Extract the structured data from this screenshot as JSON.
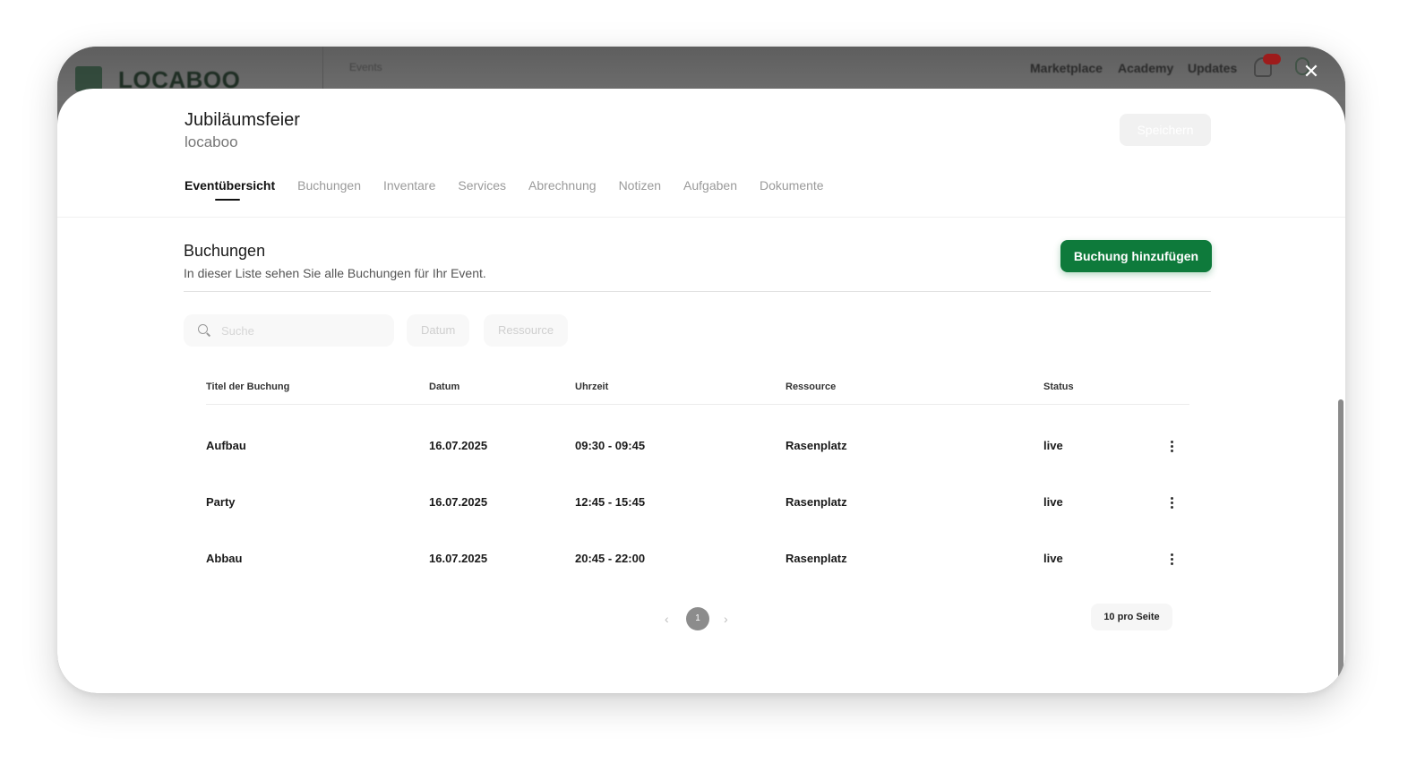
{
  "background": {
    "logo": "LOCABOO",
    "breadcrumb": "Events",
    "nav": [
      "Marketplace",
      "Academy",
      "Updates"
    ]
  },
  "modal": {
    "title": "Jubiläumsfeier",
    "subtitle": "locaboo",
    "save_label": "Speichern",
    "tabs": [
      "Eventübersicht",
      "Buchungen",
      "Inventare",
      "Services",
      "Abrechnung",
      "Notizen",
      "Aufgaben",
      "Dokumente"
    ],
    "active_tab": "Eventübersicht"
  },
  "section": {
    "title": "Buchungen",
    "description": "In dieser Liste sehen Sie alle Buchungen für Ihr Event.",
    "add_label": "Buchung hinzufügen"
  },
  "filters": {
    "search_placeholder": "Suche",
    "date_label": "Datum",
    "resource_label": "Ressource"
  },
  "table": {
    "headers": [
      "Titel der Buchung",
      "Datum",
      "Uhrzeit",
      "Ressource",
      "Status"
    ],
    "rows": [
      {
        "title": "Aufbau",
        "date": "16.07.2025",
        "time": "09:30 - 09:45",
        "resource": "Rasenplatz",
        "status": "live"
      },
      {
        "title": "Party",
        "date": "16.07.2025",
        "time": "12:45 - 15:45",
        "resource": "Rasenplatz",
        "status": "live"
      },
      {
        "title": "Abbau",
        "date": "16.07.2025",
        "time": "20:45 - 22:00",
        "resource": "Rasenplatz",
        "status": "live"
      }
    ]
  },
  "pagination": {
    "prev": "‹",
    "current_page": "1",
    "next": "›",
    "per_page": "10 pro Seite"
  },
  "colors": {
    "accent": "#0e7a3b",
    "badge": "#9e1c1c"
  }
}
